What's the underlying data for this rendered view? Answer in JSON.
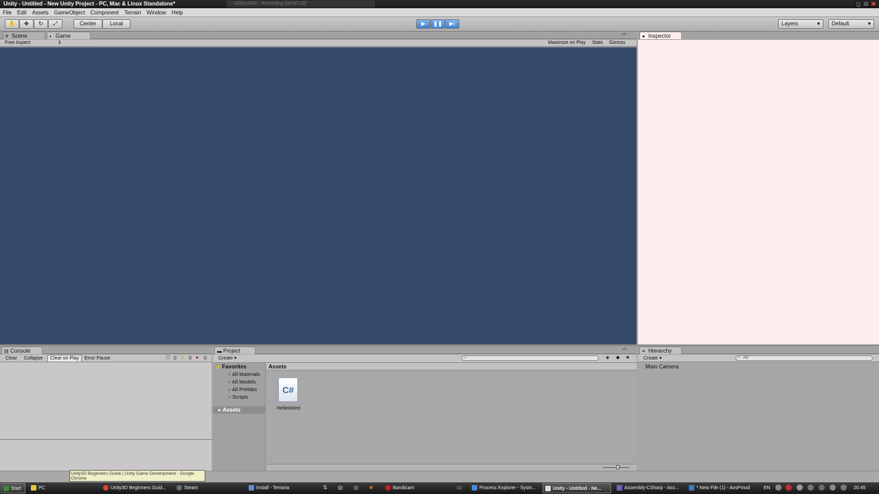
{
  "window": {
    "title": "Unity - Untitled - New Unity Project - PC, Mac & Linux Standalone*",
    "recording_overlay": "1920x1080 · Recording [00:00:18]"
  },
  "menu": [
    "File",
    "Edit",
    "Assets",
    "GameObject",
    "Component",
    "Terrain",
    "Window",
    "Help"
  ],
  "toolbar": {
    "pivot_label": "Center",
    "space_label": "Local",
    "layers_label": "Layers",
    "layout_label": "Default"
  },
  "scene_tabs": {
    "scene": "Scene",
    "game": "Game"
  },
  "game_bar": {
    "aspect": "Free Aspect",
    "maximize": "Maximize on Play",
    "stats": "Stats",
    "gizmos": "Gizmos"
  },
  "inspector": {
    "tab": "Inspector"
  },
  "console": {
    "tab": "Console",
    "buttons": [
      "Clear",
      "Collapse",
      "Clear on Play",
      "Error Pause"
    ],
    "info_count": "0",
    "warn_count": "0",
    "error_count": "0"
  },
  "project": {
    "tab": "Project",
    "create": "Create",
    "favorites_label": "Favorites",
    "favorites": [
      "All Materials",
      "All Models",
      "All Prefabs",
      "Scripts"
    ],
    "assets_root": "Assets",
    "breadcrumb": "Assets",
    "files": [
      {
        "name": "HelloWolrd",
        "icon": "C#"
      }
    ]
  },
  "hierarchy": {
    "tab": "Hierarchy",
    "create": "Create",
    "search_placeholder": "All",
    "items": [
      "Main Camera"
    ]
  },
  "status": {
    "tooltip_line1": "Unity3D Beginners Guide | Unity Game Development - Google",
    "tooltip_line2": "Chrome"
  },
  "taskbar": {
    "start": "Start",
    "items": [
      "PC",
      "Unity3D Beginners Guid...",
      "Steam",
      "Install - Terraria",
      "Bandicam",
      "Process Explorer - Sysin...",
      "Unity - Untitled - Ne...",
      "Assembly-CSharp - Ass...",
      "* New File (1) - AvsPmod"
    ],
    "lang": "EN",
    "clock": "20:45"
  }
}
